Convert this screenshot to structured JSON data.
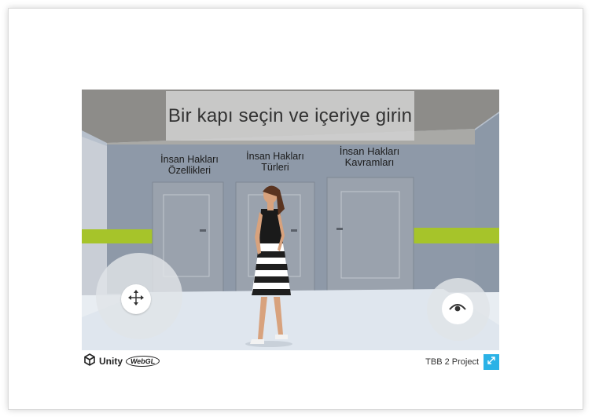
{
  "game": {
    "banner_text": "Bir kapı seçin ve içeriye girin",
    "doors": [
      {
        "line1": "İnsan Hakları",
        "line2": "Özellikleri"
      },
      {
        "line1": "İnsan Hakları",
        "line2": "Türleri"
      },
      {
        "line1": "İnsan Hakları",
        "line2": "Kavramları"
      }
    ],
    "move_joystick_icon": "move-arrows-icon",
    "look_button_icon": "eye-icon"
  },
  "footer": {
    "brand": "Unity",
    "webgl": "WebGL",
    "project_title": "TBB 2 Project",
    "fullscreen_icon": "fullscreen-icon"
  },
  "colors": {
    "accent_stripe": "#a6c42a",
    "fullscreen_button": "#2bb2e6",
    "wall": "#8b97a6",
    "ceiling": "#8a8a88"
  }
}
